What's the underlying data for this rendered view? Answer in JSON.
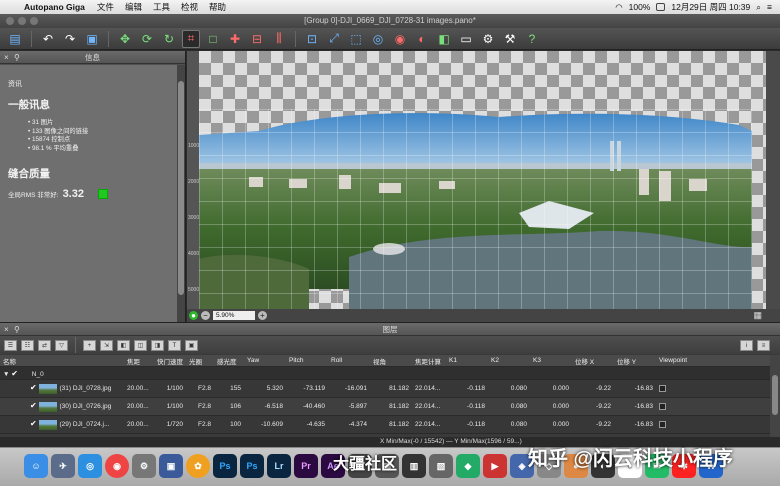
{
  "menubar": {
    "app_name": "Autopano Giga",
    "items": [
      "文件",
      "编辑",
      "工具",
      "检视",
      "帮助"
    ],
    "battery": "100%",
    "datetime": "12月29日 周四 10:39"
  },
  "window": {
    "title": "[Group 0]-DJI_0669_DJI_0728-31 images.pano*"
  },
  "left_panel": {
    "header": "信息",
    "section_label": "资讯",
    "general_title": "一般讯息",
    "stats": [
      "31 图片",
      "133 图像之间的链接",
      "15874 控制点",
      "98.1 % 平均重叠"
    ],
    "quality_title": "缝合质量",
    "rms_label": "全局RMS 非常好:",
    "rms_value": "3.32"
  },
  "viewer": {
    "zoom": "5.90%",
    "ruler_ticks": [
      "1000",
      "2000",
      "3000",
      "4000",
      "5000"
    ]
  },
  "images_panel": {
    "header": "图层",
    "columns": [
      "名称",
      "焦距",
      "快门速度",
      "光圈",
      "感光度",
      "Yaw",
      "Pitch",
      "Roll",
      "视角",
      "焦距计算",
      "K1",
      "K2",
      "K3",
      "位移 X",
      "位移 Y",
      "Viewpoint"
    ],
    "group_name": "N_0",
    "rows": [
      [
        "(31) DJI_0728.jpg",
        "20.00...",
        "1/100",
        "F2.8",
        "155",
        "5.320",
        "-73.119",
        "-16.091",
        "81.182",
        "22.014...",
        "-0.118",
        "0.080",
        "0.000",
        "-9.22",
        "-16.83"
      ],
      [
        "(30) DJI_0726.jpg",
        "20.00...",
        "1/100",
        "F2.8",
        "106",
        "-6.518",
        "-40.460",
        "-5.897",
        "81.182",
        "22.014...",
        "-0.118",
        "0.080",
        "0.000",
        "-9.22",
        "-16.83"
      ],
      [
        "(29) DJI_0724.j...",
        "20.00...",
        "1/720",
        "F2.8",
        "100",
        "-10.609",
        "-4.635",
        "-4.374",
        "81.182",
        "22.014...",
        "-0.118",
        "0.080",
        "0.000",
        "-9.22",
        "-16.83"
      ]
    ]
  },
  "statusbar": {
    "text": "X Min/Max(-0 / 15542)  —  Y Min/Max(1596 / 59...)"
  },
  "watermarks": {
    "left": "大疆社区",
    "right": "知乎 @闪云科技小程序"
  }
}
